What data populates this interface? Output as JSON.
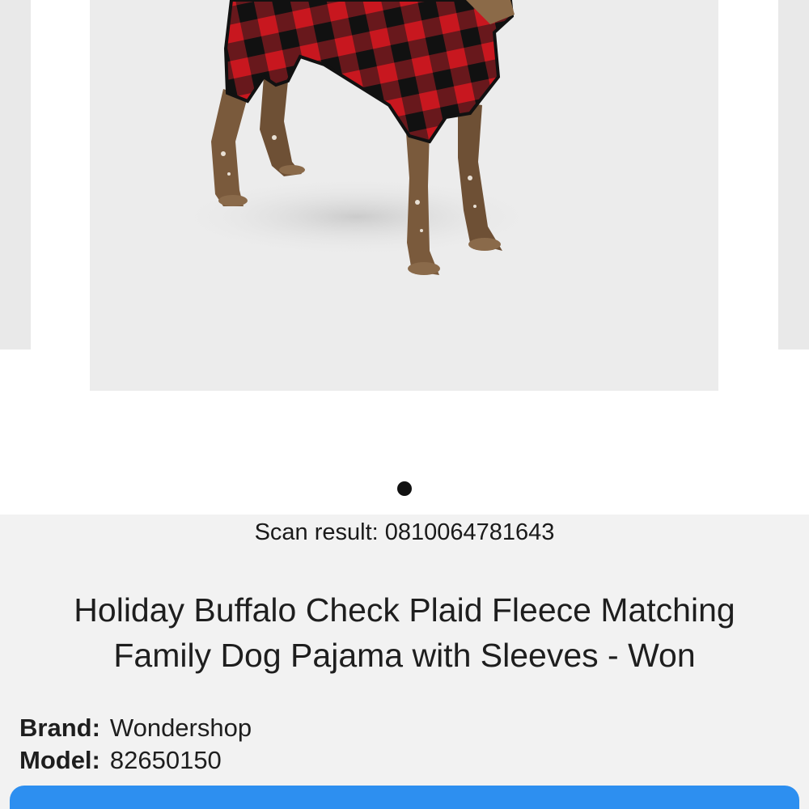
{
  "carousel": {
    "image_alt": "Dog wearing red and black buffalo check plaid fleece pajama",
    "page_count": 1,
    "current_page": 1
  },
  "scan": {
    "label": "Scan result:",
    "code": "0810064781643",
    "text": "Scan result: 0810064781643"
  },
  "product": {
    "title_line1": "Holiday Buffalo Check Plaid Fleece Matching",
    "title_line2": "Family Dog Pajama with Sleeves - Won",
    "brand_label": "Brand:",
    "brand_value": "Wondershop",
    "model_label": "Model:",
    "model_value": "82650150"
  },
  "colors": {
    "accent_button": "#2d8ff0",
    "plaid_red": "#c8171f",
    "plaid_black": "#1a1a1a",
    "panel_bg": "#f2f2f2"
  }
}
